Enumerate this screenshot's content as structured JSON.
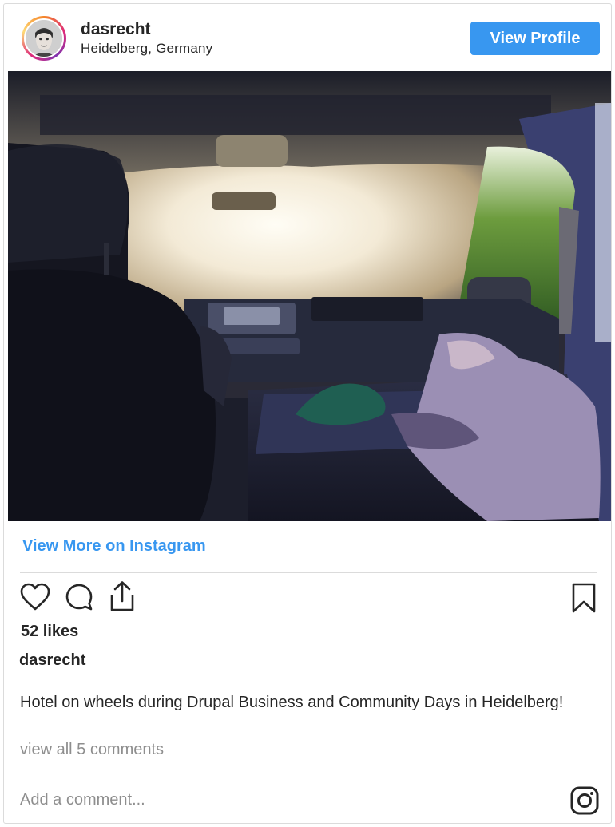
{
  "header": {
    "username": "dasrecht",
    "location": "Heidelberg, Germany",
    "view_profile_label": "View Profile"
  },
  "post": {
    "view_more_label": "View More on Instagram",
    "likes_text": "52 likes",
    "caption_username": "dasrecht",
    "caption": "Hotel on wheels during Drupal Business and Community Days in Heidelberg!",
    "view_comments_label": "view all 5 comments"
  },
  "comment_box": {
    "placeholder": "Add a comment..."
  },
  "icons": {
    "like": "heart-icon",
    "comment": "comment-icon",
    "share": "share-icon",
    "save": "bookmark-icon",
    "brand": "instagram-icon"
  },
  "colors": {
    "accent": "#3897f0",
    "text": "#262626",
    "muted": "#8e8e8e",
    "border": "#dbdbdb"
  }
}
